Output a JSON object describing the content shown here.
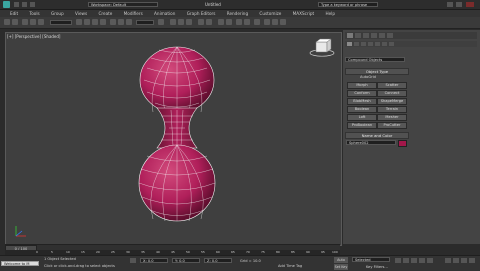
{
  "titlebar": {
    "workspace": "Workspace: Default",
    "file": "Untitled",
    "search_placeholder": "Type a keyword or phrase"
  },
  "menus": [
    "Edit",
    "Tools",
    "Group",
    "Views",
    "Create",
    "Modifiers",
    "Animation",
    "Graph Editors",
    "Rendering",
    "Customize",
    "MAXScript",
    "Help"
  ],
  "viewport": {
    "label": "[+] [Perspective] [Shaded]"
  },
  "cmdpanel": {
    "dropdown": "Compound Objects",
    "object_type_header": "Object Type",
    "autogrid": "AutoGrid",
    "buttons": [
      [
        "Morph",
        "Scatter"
      ],
      [
        "Conform",
        "Connect"
      ],
      [
        "BlobMesh",
        "ShapeMerge"
      ],
      [
        "Boolean",
        "Terrain"
      ],
      [
        "Loft",
        "Mesher"
      ],
      [
        "ProBoolean",
        "ProCutter"
      ]
    ],
    "name_color_header": "Name and Color",
    "object_name": "Sphere002",
    "object_color": "#a3174a"
  },
  "timeline": {
    "frame_counter": "0 / 100",
    "ticks": [
      "0",
      "5",
      "10",
      "15",
      "20",
      "25",
      "30",
      "35",
      "40",
      "45",
      "50",
      "55",
      "60",
      "65",
      "70",
      "75",
      "80",
      "85",
      "90",
      "95",
      "100"
    ]
  },
  "status": {
    "welcome": "Welcome to M",
    "selection": "1 Object Selected",
    "prompt": "Click or click-and-drag to select objects",
    "add_time_tag": "Add Time Tag",
    "x": "X: 0.0",
    "y": "Y: 0.0",
    "z": "Z: 0.0",
    "grid": "Grid = 10.0",
    "auto_key": "Auto Key",
    "set_key": "Set Key",
    "selected": "Selected",
    "key_filters": "Key Filters..."
  },
  "colors": {
    "viewport_bg": "#3f3f3f",
    "object_primary": "#b01f5a",
    "object_dark": "#5f0e2e",
    "wire": "#f3f3f3",
    "panel_bg": "#444444",
    "accent_color_swatch": "#a3174a"
  }
}
